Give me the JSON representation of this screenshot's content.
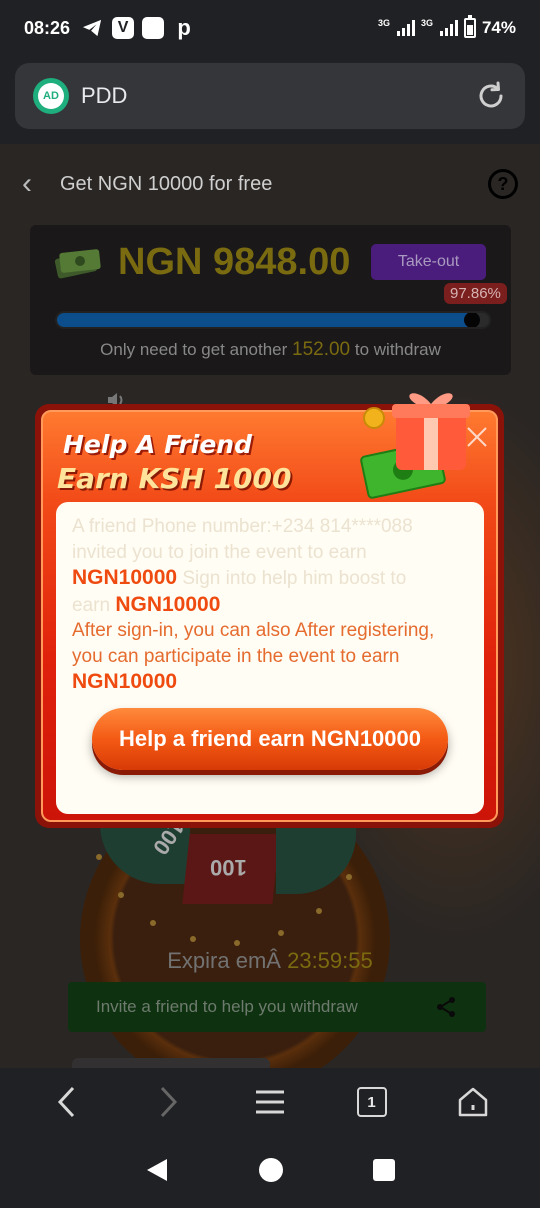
{
  "status_bar": {
    "time": "08:26",
    "network_1": "3G",
    "network_2": "3G",
    "battery_percent": "74%",
    "battery_level": 0.74,
    "app_icons": [
      "telegram-icon",
      "vpn-v-icon",
      "blank-app-icon",
      "p-app-icon"
    ]
  },
  "browser": {
    "site_badge": "AD",
    "url_title": "PDD"
  },
  "page": {
    "back_glyph": "‹",
    "header_title": "Get NGN 10000 for free",
    "help_glyph": "?",
    "balance": "NGN 9848.00",
    "takeout_label": "Take-out",
    "progress_percent": "97.86%",
    "progress_fraction": 0.9786,
    "need_prefix": "Only need to get another",
    "need_amount": "152.00",
    "need_suffix": "to withdraw",
    "wheel_label_1": "100",
    "wheel_label_2": "100",
    "expire_prefix": "Expira emÂ",
    "expire_time": "23:59:55",
    "invite_label": "Invite a friend to help you withdraw"
  },
  "modal": {
    "title_line_1": "Help A Friend",
    "title_line_2": "Earn KSH 1000",
    "faded_line_1": "A friend Phone number:+234 814****088",
    "faded_line_2": "invited you to join the event to earn",
    "amount_1": "NGN10000",
    "faded_line_3": "Sign into help him boost to",
    "faded_line_4": "earn",
    "amount_2": "NGN10000",
    "body_line_1": "After sign-in, you can also After registering,",
    "body_line_2": "you can participate in the event to earn",
    "amount_3": "NGN10000",
    "action_label": "Help a friend earn NGN10000"
  },
  "bottom_nav": {
    "tab_count": "1"
  },
  "colors": {
    "accent_gold": "#7a6a10",
    "modal_orange": "#f24a18",
    "invite_green": "#0e3210"
  }
}
